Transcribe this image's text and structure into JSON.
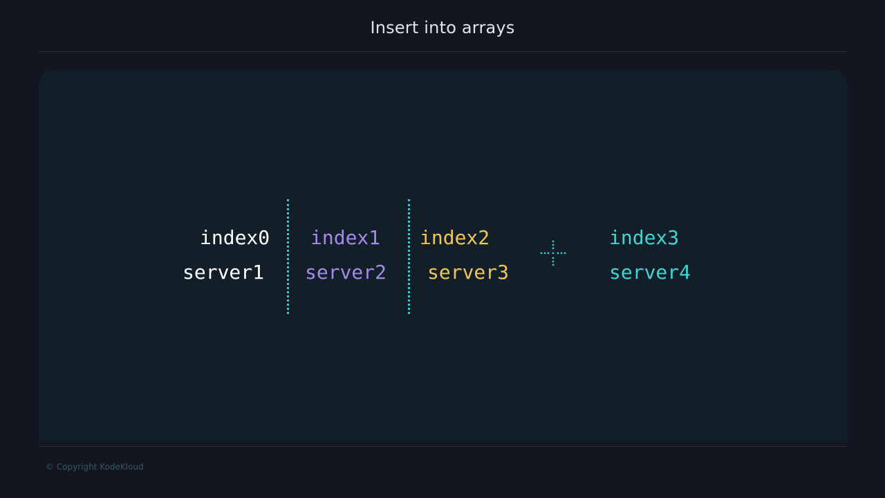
{
  "slide": {
    "title": "Insert into arrays",
    "copyright": "© Copyright KodeKloud"
  },
  "colors": {
    "background": "#131621",
    "panel": "#131f28",
    "divider": "#3cc8cf",
    "plus": "#3cc8cf"
  },
  "array": {
    "columns": [
      {
        "index": "index0",
        "value": "server1",
        "color": "#ffffff"
      },
      {
        "index": "index1",
        "value": "server2",
        "color": "#a38bea"
      },
      {
        "index": "index2",
        "value": "server3",
        "color": "#f0c659"
      },
      {
        "index": "index3",
        "value": "server4",
        "color": "#43d3d3"
      }
    ],
    "insert_icon": "plus-icon"
  }
}
